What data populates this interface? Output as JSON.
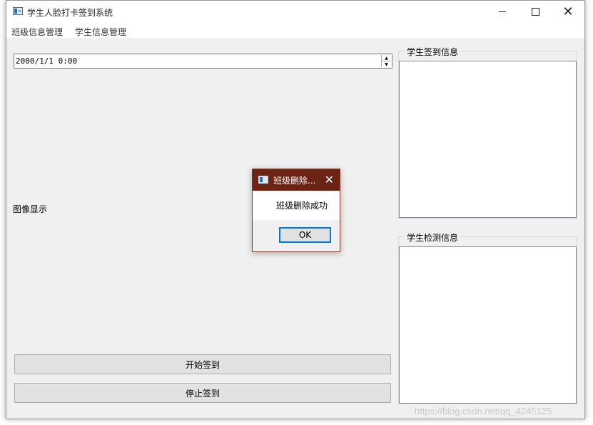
{
  "window": {
    "title": "学生人脸打卡签到系统",
    "menu": [
      "班级信息管理",
      "学生信息管理"
    ]
  },
  "main": {
    "datetime_value": "2000/1/1 0:00",
    "image_label": "图像显示",
    "start_button": "开始签到",
    "stop_button": "停止签到"
  },
  "panels": {
    "sign_in_title": "学生签到信息",
    "detect_title": "学生检测信息"
  },
  "dialog": {
    "title": "班级删除...",
    "message": "班级删除成功",
    "ok_label": "OK"
  },
  "background": {
    "watermark": "https://blog.csdn.net/qq_4245125"
  },
  "colors": {
    "dialog_titlebar": "#6b2414",
    "focus_border": "#0078d7",
    "window_bg": "#f0f0f0"
  }
}
